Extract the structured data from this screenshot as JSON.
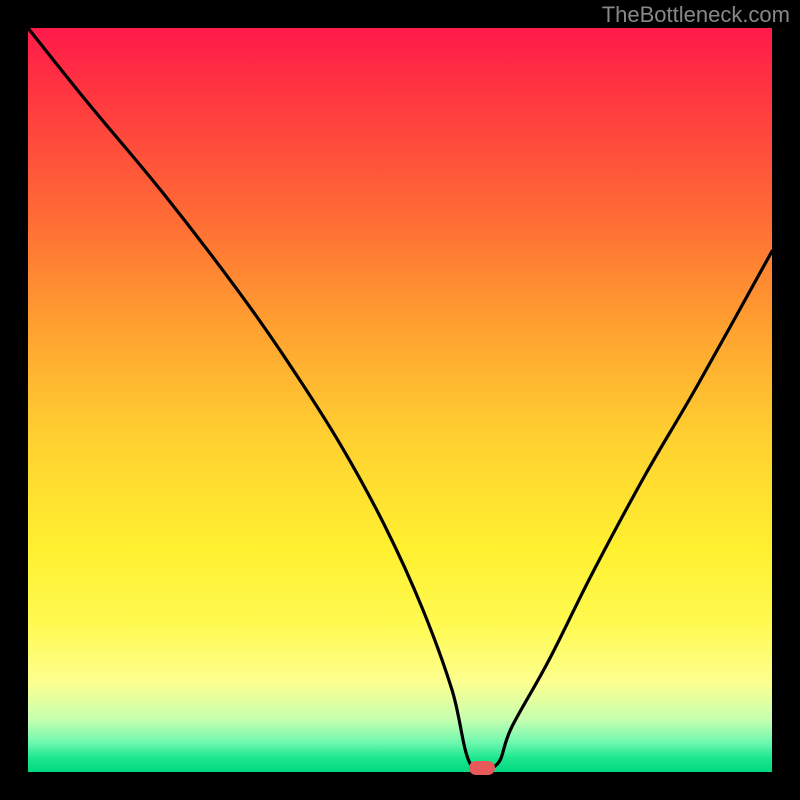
{
  "watermark": "TheBottleneck.com",
  "chart_data": {
    "type": "line",
    "title": "",
    "xlabel": "",
    "ylabel": "",
    "xlim": [
      0,
      100
    ],
    "ylim": [
      0,
      100
    ],
    "series": [
      {
        "name": "curve",
        "x": [
          0,
          8,
          18,
          28,
          35,
          42,
          48,
          53,
          57,
          59.5,
          63,
          65,
          70,
          76,
          83,
          90,
          100
        ],
        "values": [
          100,
          90,
          78,
          65,
          55,
          44,
          33,
          22,
          11,
          1,
          1,
          6,
          15,
          27,
          40,
          52,
          70
        ]
      }
    ],
    "marker": {
      "x": 61,
      "y": 0.5
    },
    "background_gradient": {
      "top": "#ff1a4a",
      "bottom": "#00d880"
    }
  }
}
